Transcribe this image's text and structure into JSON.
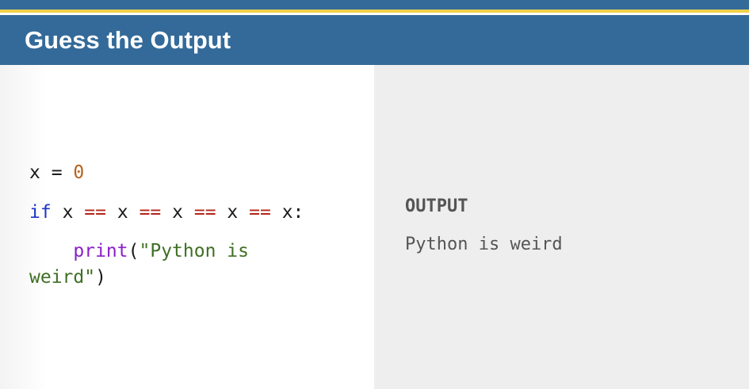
{
  "header": {
    "title": "Guess the Output"
  },
  "code": {
    "line1": {
      "var": "x",
      "assign": " = ",
      "value": "0"
    },
    "line2": {
      "keyword": "if",
      "operand": "x",
      "operator": "==",
      "colon": ":"
    },
    "line3": {
      "indent": "    ",
      "function": "print",
      "open_paren": "(",
      "string_part1": "\"Python is"
    },
    "line4": {
      "string_part2": "weird\"",
      "close_paren": ")"
    }
  },
  "output": {
    "heading": "OUTPUT",
    "text": "Python is weird"
  },
  "colors": {
    "header_bg": "#336a99",
    "accent_stripe": "#f2d14a",
    "keyword": "#1f35c7",
    "operator": "#b3251b",
    "number": "#b6611a",
    "function": "#8a1fc9",
    "string": "#3f6f23",
    "output_panel_bg": "#eeeeee"
  }
}
